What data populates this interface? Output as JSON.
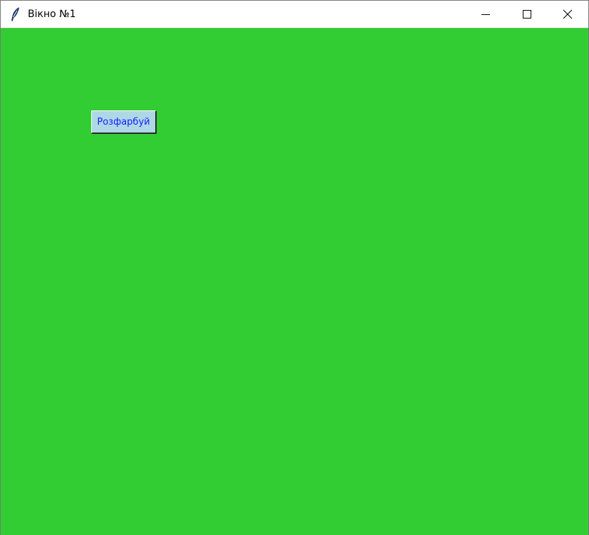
{
  "window": {
    "title": "Вікно №1",
    "background_color": "#32cd32"
  },
  "titlebar": {
    "app_icon": "feather-icon",
    "minimize_icon": "minimize-icon",
    "maximize_icon": "maximize-icon",
    "close_icon": "close-icon"
  },
  "main": {
    "button_label": "Розфарбуй",
    "button_bg": "#add8e6",
    "button_fg": "#1a1aff"
  }
}
